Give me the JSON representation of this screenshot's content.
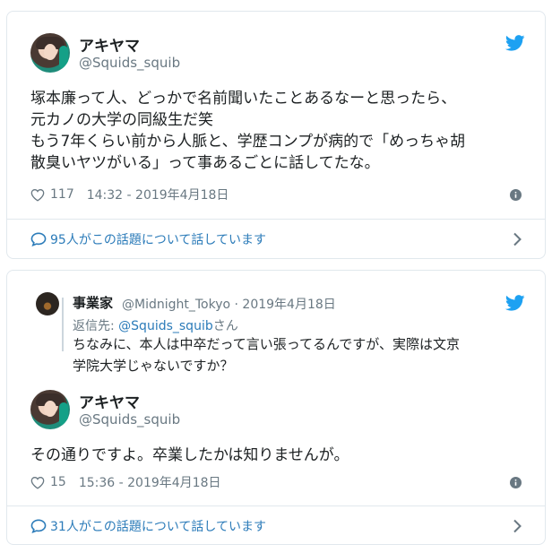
{
  "colors": {
    "link": "#2b7bb9",
    "muted": "#697882",
    "text": "#1c2022",
    "border": "#e1e8ed",
    "twitter_blue": "#1da1f2"
  },
  "tweet1": {
    "name": "アキヤマ",
    "handle": "@Squids_squib",
    "text": "塚本廉って人、どっかで名前聞いたことあるなーと思ったら、\n元カノの大学の同級生だ笑\nもう7年くらい前から人脈と、学歴コンプが病的で「めっちゃ胡\n散臭いヤツがいる」って事あるごとに話してたな。",
    "likes": "117",
    "timestamp": "14:32 - 2019年4月18日",
    "conversation": "95人がこの話題について話しています"
  },
  "quoted": {
    "name": "事業家",
    "handle": "@Midnight_Tokyo · 2019年4月18日",
    "reply_prefix": "返信先: ",
    "reply_handle": "@Squids_squib",
    "reply_suffix": "さん",
    "text": "ちなみに、本人は中卒だって言い張ってるんですが、実際は文京\n学院大学じゃないですか？"
  },
  "tweet2": {
    "name": "アキヤマ",
    "handle": "@Squids_squib",
    "text": "その通りですよ。卒業したかは知りませんが。",
    "likes": "15",
    "timestamp": "15:36 - 2019年4月18日",
    "conversation": "31人がこの話題について話しています"
  }
}
